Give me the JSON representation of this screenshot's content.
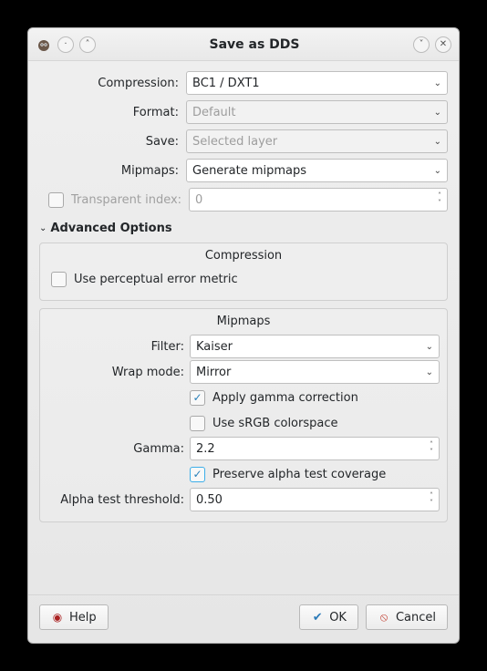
{
  "window": {
    "title": "Save as DDS"
  },
  "fields": {
    "compression": {
      "label": "Compression:",
      "value": "BC1 / DXT1"
    },
    "format": {
      "label": "Format:",
      "value": "Default"
    },
    "save": {
      "label": "Save:",
      "value": "Selected layer"
    },
    "mipmaps": {
      "label": "Mipmaps:",
      "value": "Generate mipmaps"
    },
    "transparent_index": {
      "label": "Transparent index:",
      "value": "0"
    }
  },
  "advanced": {
    "header": "Advanced Options",
    "compression_panel": {
      "title": "Compression",
      "perceptual": {
        "label": "Use perceptual error metric",
        "checked": false
      }
    },
    "mipmaps_panel": {
      "title": "Mipmaps",
      "filter": {
        "label": "Filter:",
        "value": "Kaiser"
      },
      "wrap": {
        "label": "Wrap mode:",
        "value": "Mirror"
      },
      "gamma_correction": {
        "label": "Apply gamma correction",
        "checked": true
      },
      "srgb": {
        "label": "Use sRGB colorspace",
        "checked": false
      },
      "gamma": {
        "label": "Gamma:",
        "value": "2.2"
      },
      "preserve_alpha": {
        "label": "Preserve alpha test coverage",
        "checked": true
      },
      "alpha_threshold": {
        "label": "Alpha test threshold:",
        "value": "0.50"
      }
    }
  },
  "buttons": {
    "help": "Help",
    "ok": "OK",
    "cancel": "Cancel"
  }
}
